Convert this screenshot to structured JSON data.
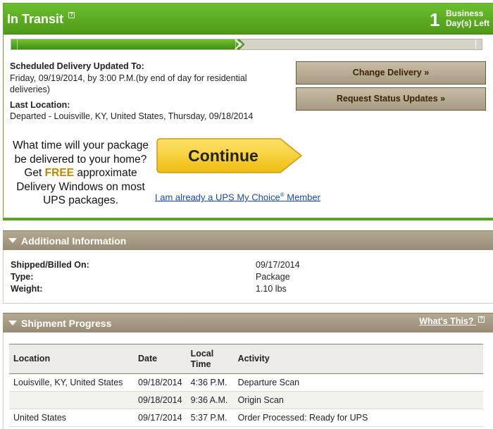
{
  "transit": {
    "status_title": "In Transit",
    "days_count": "1",
    "days_label_line1": "Business",
    "days_label_line2": "Day(s) Left",
    "progress_fraction": 0.485
  },
  "delivery": {
    "scheduled_label": "Scheduled Delivery Updated To:",
    "scheduled_value": "Friday, 09/19/2014, by 3:00 P.M.(by end of day for residential deliveries)",
    "last_location_label": "Last Location:",
    "last_location_value": "Departed - Louisville, KY, United States, Thursday, 09/18/2014"
  },
  "actions": {
    "change_delivery": "Change Delivery »",
    "request_updates": "Request Status Updates »"
  },
  "promo": {
    "line1": "What time will your package be delivered to your home? Get",
    "free": "FREE",
    "line2": "approximate Delivery Windows on most UPS packages.",
    "continue_label": "Continue",
    "mychoice_link_pre": "I am already a UPS My Choice",
    "mychoice_link_reg": "®",
    "mychoice_link_post": " Member"
  },
  "additional_info": {
    "title": "Additional Information",
    "rows": [
      {
        "key": "Shipped/Billed On:",
        "value": "09/17/2014"
      },
      {
        "key": "Type:",
        "value": "Package"
      },
      {
        "key": "Weight:",
        "value": "1.10 lbs"
      }
    ]
  },
  "shipment_progress": {
    "title": "Shipment Progress",
    "whats_this": "What's This?",
    "columns": {
      "location": "Location",
      "date": "Date",
      "time_line1": "Local",
      "time_line2": "Time",
      "activity": "Activity"
    },
    "rows": [
      {
        "location": "Louisville, KY, United States",
        "date": "09/18/2014",
        "time": "4:36 P.M.",
        "activity": "Departure Scan"
      },
      {
        "location": "",
        "date": "09/18/2014",
        "time": "9:36 A.M.",
        "activity": "Origin Scan"
      },
      {
        "location": "United States",
        "date": "09/17/2014",
        "time": "5:37 P.M.",
        "activity": "Order Processed: Ready for UPS"
      }
    ]
  },
  "colors": {
    "green_header": "#57a51f",
    "brown_header": "#a89d86",
    "button_text": "#3b2306",
    "continue_yellow": "#f6cf2a",
    "free_text": "#b78a00",
    "link": "#1a4aa8"
  },
  "icons": {
    "help": "help-icon",
    "collapse": "caret-down-icon",
    "continue_shape": "arrow-button-icon"
  }
}
